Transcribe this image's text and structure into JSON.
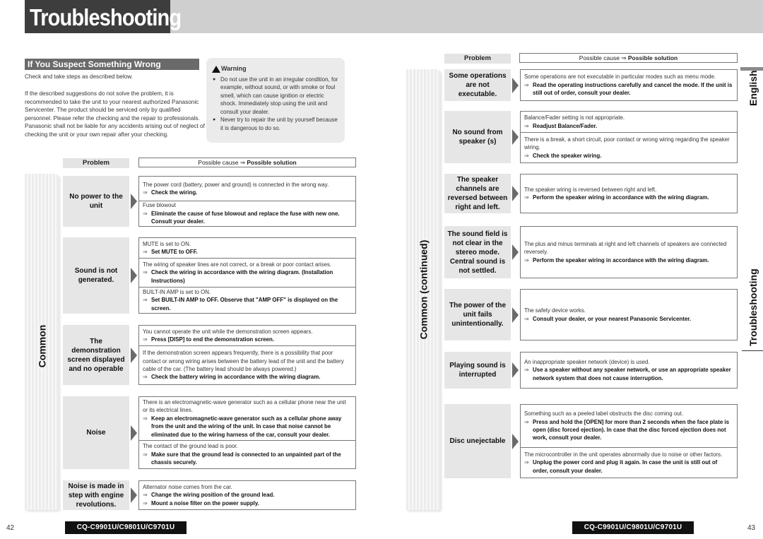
{
  "page_title": "Troubleshooting",
  "section_heading": "If You Suspect Something Wrong",
  "intro": {
    "line1": "Check and take steps as described below.",
    "para2": "If the described suggestions do not solve the problem, it is recommended to take the unit to your nearest authorized Panasonic Servicenter. The product should be serviced only by qualified personnel. Please refer the checking and the repair to professionals. Panasonic shall not be liable for any accidents arising out of neglect of checking the unit or your own repair after your checking."
  },
  "warning": {
    "title": "Warning",
    "icon": "warning-triangle-icon",
    "items": [
      "Do not use the unit in an irregular condition, for example, without sound, or with smoke or foul smell, which can cause ignition or electric shock. Immediately stop using the unit and consult your dealer.",
      "Never try to repair the unit by yourself because it is dangerous to do so."
    ]
  },
  "table_header": {
    "problem": "Problem",
    "cause_prefix": "Possible cause",
    "arrow": "⇒",
    "solution": "Possible solution"
  },
  "left_tab": "Common",
  "right_tab": "Common (continued)",
  "left_rows": [
    {
      "problem": "No power to the unit",
      "causes": [
        {
          "cause": "The power cord (battery, power and ground) is connected in the wrong way.",
          "solutions": [
            "Check the wiring."
          ]
        },
        {
          "cause": "Fuse blowout",
          "solutions": [
            "Eliminate the cause of fuse blowout and replace the fuse with new one. Consult your dealer."
          ]
        }
      ]
    },
    {
      "problem": "Sound is not generated.",
      "causes": [
        {
          "cause": "MUTE is set to ON.",
          "solutions": [
            "Set MUTE to OFF."
          ]
        },
        {
          "cause": "The wiring of speaker lines are not correct, or a break or poor contact arises.",
          "solutions": [
            "Check the wiring in accordance with the wiring diagram. (Installation Instructions)"
          ]
        },
        {
          "cause": "BUILT-IN AMP is set to ON.",
          "solutions": [
            "Set BUILT-IN AMP to OFF. Observe that \"AMP OFF\" is displayed on the screen."
          ]
        }
      ]
    },
    {
      "problem": "The demonstration screen displayed and no operable",
      "causes": [
        {
          "cause": "You cannot operate the unit while the demonstration screen appears.",
          "solutions": [
            "Press [DISP] to end the demonstration screen."
          ]
        },
        {
          "cause": "If the demonstration screen appears frequently, there is a possibility that poor contact or wrong wiring arises between the battery lead of the unit and the battery cable of the car. (The battery lead should be always powered.)",
          "solutions": [
            "Check the battery wiring in accordance with the wiring diagram."
          ]
        }
      ]
    },
    {
      "problem": "Noise",
      "causes": [
        {
          "cause": "There is an electromagnetic-wave generator such as a cellular phone near the unit or its electrical lines.",
          "solutions": [
            "Keep an electromagnetic-wave generator such as a cellular phone away from the unit and the wiring of the unit. In case that noise cannot be eliminated due to the wiring harness of the car, consult your dealer."
          ]
        },
        {
          "cause": "The contact of the ground lead is poor.",
          "solutions": [
            "Make sure that the ground lead is connected to an unpainted part of the chassis securely."
          ]
        }
      ]
    },
    {
      "problem": "Noise is made in step with engine revolutions.",
      "causes": [
        {
          "cause": "Alternator noise comes from the car.",
          "solutions": [
            "Change the wiring position of the ground lead.",
            "Mount a noise filter on the power supply."
          ]
        }
      ]
    }
  ],
  "right_rows": [
    {
      "problem": "Some operations are not executable.",
      "causes": [
        {
          "cause": "Some operations are not executable in particular modes such as menu mode.",
          "solutions": [
            "Read the operating instructions carefully and cancel the mode. If the unit is still out of order, consult your dealer."
          ]
        }
      ]
    },
    {
      "problem": "No sound from speaker (s)",
      "causes": [
        {
          "cause": "Balance/Fader setting is not appropriate.",
          "solutions": [
            "Readjust Balance/Fader."
          ]
        },
        {
          "cause": "There is a break, a short circuit, poor contact or wrong wiring regarding the speaker wiring.",
          "solutions": [
            "Check the speaker wiring."
          ]
        }
      ]
    },
    {
      "problem": "The speaker channels are reversed between right and left.",
      "causes": [
        {
          "cause": "The speaker wiring is reversed between right and left.",
          "solutions": [
            "Perform the speaker wiring in accordance with the wiring diagram."
          ]
        }
      ]
    },
    {
      "problem": "The sound field is not clear in the stereo mode. Central sound is not settled.",
      "causes": [
        {
          "cause": "The plus and minus terminals at right and left channels of speakers are connected reversely.",
          "solutions": [
            "Perform the speaker wiring in accordance with the wiring diagram."
          ]
        }
      ]
    },
    {
      "problem": "The power of the unit fails unintentionally.",
      "causes": [
        {
          "cause": "The safety device works.",
          "solutions": [
            "Consult your dealer, or your nearest Panasonic Servicenter."
          ]
        }
      ]
    },
    {
      "problem": "Playing sound is interrupted",
      "causes": [
        {
          "cause": "An inappropriate speaker network (device) is used.",
          "solutions": [
            "Use a speaker without any speaker network, or use an appropriate speaker network system that does not cause interruption."
          ]
        }
      ]
    },
    {
      "problem": "Disc unejectable",
      "causes": [
        {
          "cause": "Something such as a peeled label obstructs the disc coming out.",
          "solutions": [
            "Press and hold the [OPEN] for more than 2 seconds when the face plate is open (disc forced ejection). In case that the disc forced ejection does not work, consult your dealer."
          ]
        },
        {
          "cause": "The microcontroller in the unit operates abnormally due to noise or other factors.",
          "solutions": [
            "Unplug the power cord and plug it again. In case the unit is still out of order, consult your dealer."
          ]
        }
      ]
    }
  ],
  "side_tabs": {
    "language": "English",
    "chapter": "Troubleshooting"
  },
  "footer": {
    "left_page": "42",
    "right_page": "43",
    "model": "CQ-C9901U/C9801U/C9701U"
  }
}
